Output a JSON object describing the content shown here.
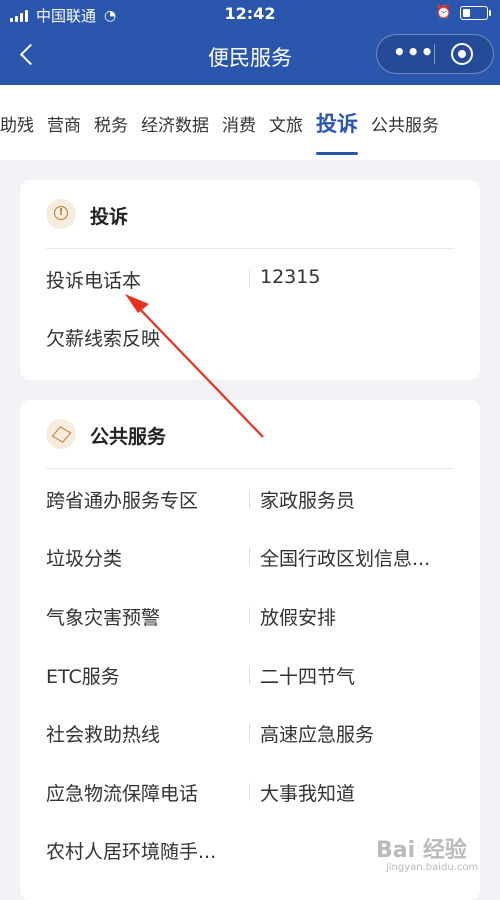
{
  "status": {
    "carrier": "中国联通",
    "time": "12:42",
    "icons": [
      "signal-icon",
      "wifi-icon",
      "alarm-icon",
      "battery-icon"
    ]
  },
  "nav": {
    "title": "便民服务",
    "back_icon": "chevron-left-icon",
    "more_icon": "more-dots-icon",
    "close_icon": "target-icon"
  },
  "tabs": [
    {
      "label": "助残"
    },
    {
      "label": "营商"
    },
    {
      "label": "税务"
    },
    {
      "label": "经济数据"
    },
    {
      "label": "消费"
    },
    {
      "label": "文旅"
    },
    {
      "label": "投诉",
      "active": true
    },
    {
      "label": "公共服务"
    }
  ],
  "complaint": {
    "title": "投诉",
    "icon": "warning-icon",
    "rows": [
      {
        "left": "投诉电话本",
        "right": "12315"
      },
      {
        "left": "欠薪线索反映",
        "right": ""
      }
    ]
  },
  "public_service": {
    "title": "公共服务",
    "icon": "box-icon",
    "rows": [
      {
        "left": "跨省通办服务专区",
        "right": "家政服务员"
      },
      {
        "left": "垃圾分类",
        "right": "全国行政区划信息..."
      },
      {
        "left": "气象灾害预警",
        "right": "放假安排"
      },
      {
        "left": "ETC服务",
        "right": "二十四节气"
      },
      {
        "left": "社会救助热线",
        "right": "高速应急服务"
      },
      {
        "left": "应急物流保障电话",
        "right": "大事我知道"
      },
      {
        "left": "农村人居环境随手...",
        "right": ""
      }
    ]
  },
  "colors": {
    "primary": "#2b56ad",
    "annotation_arrow": "#e8321e",
    "icon_accent": "#b77a2d"
  },
  "watermark": {
    "text": "Bai 经验",
    "sub": "jingyan.baidu.com"
  }
}
